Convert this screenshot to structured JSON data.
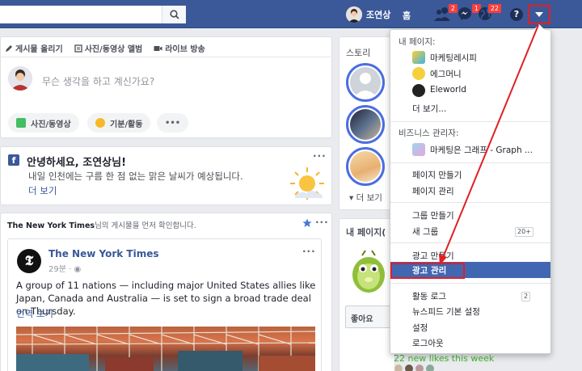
{
  "header": {
    "user_name": "조연상",
    "home_label": "홈",
    "badges": {
      "friends": "2",
      "messages": "1",
      "notifications": "22"
    },
    "help_label": "?"
  },
  "composer": {
    "tabs": [
      "게시물 올리기",
      "사진/동영상 앨범",
      "라이브 방송"
    ],
    "placeholder": "무슨 생각을 하고 계신가요?",
    "actions": [
      "사진/동영상",
      "기분/활동",
      "•••"
    ]
  },
  "greeting": {
    "title": "안녕하세요, 조연상님!",
    "text": "내일 인천에는 구름 한 점 없는 맑은 날씨가 예상됩니다.",
    "more": "더 보기"
  },
  "feed": {
    "seen_first_source": "The New York Times",
    "seen_first_text": "님의 게시물을 먼저 확인합니다.",
    "post": {
      "author": "The New York Times",
      "time": "29분",
      "body": "A group of 11 nations — including major United States allies like Japan, Canada and Australia — is set to sign a broad trade deal on Thursday.",
      "translate": "번역 보기"
    }
  },
  "right_column": {
    "stories_title": "스토리",
    "stories_more": "더 보기",
    "my_pages_title": "내 페이지(",
    "like_button": "좋아요",
    "new_likes": "22 new likes this week"
  },
  "dropdown": {
    "my_pages_header": "내 페이지:",
    "pages": [
      "마케팅레시피",
      "에그머니",
      "Eleworld"
    ],
    "more": "더 보기...",
    "business_header": "비즈니스 관리자:",
    "business_item": "마케팅은 그래프 - Graph ...",
    "create_page": "페이지 만들기",
    "manage_pages": "페이지 관리",
    "create_group": "그룹 만들기",
    "new_groups": "새 그룹",
    "new_groups_count": "20+",
    "create_ad": "광고 만들기",
    "manage_ads": "광고 관리",
    "activity_log": "활동 로그",
    "activity_count": "2",
    "newsfeed_settings": "뉴스피드 기본 설정",
    "settings": "설정",
    "logout": "로그아웃"
  }
}
